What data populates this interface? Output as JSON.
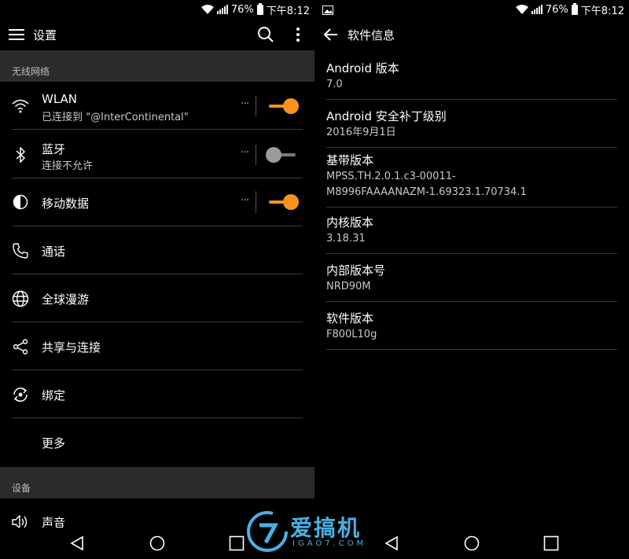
{
  "status_bar": {
    "battery": "76%",
    "time": "下午8:12"
  },
  "left": {
    "toolbar": {
      "title": "设置"
    },
    "sections": {
      "wireless": "无线网络",
      "device": "设备"
    },
    "items": {
      "wlan": {
        "label": "WLAN",
        "sub": "已连接到 \"@InterContinental\"",
        "more": "···",
        "toggle": "on"
      },
      "bluetooth": {
        "label": "蓝牙",
        "sub": "连接不允许",
        "more": "···",
        "toggle": "off"
      },
      "mobile_data": {
        "label": "移动数据",
        "more": "···",
        "toggle": "on"
      },
      "calls": {
        "label": "通话"
      },
      "global_roaming": {
        "label": "全球漫游"
      },
      "share_connect": {
        "label": "共享与连接"
      },
      "tethering": {
        "label": "绑定"
      },
      "more": {
        "label": "更多"
      },
      "sound": {
        "label": "声音"
      }
    }
  },
  "right": {
    "toolbar": {
      "title": "软件信息"
    },
    "info": [
      {
        "key": "Android 版本",
        "value": "7.0"
      },
      {
        "key": "Android 安全补丁级别",
        "value": "2016年9月1日"
      },
      {
        "key": "基带版本",
        "value": "MPSS.TH.2.0.1.c3-00011-",
        "value2": "M8996FAAAANAZM-1.69323.1.70734.1"
      },
      {
        "key": "内核版本",
        "value": "3.18.31"
      },
      {
        "key": "内部版本号",
        "value": "NRD90M"
      },
      {
        "key": "软件版本",
        "value": "F800L10g"
      }
    ]
  },
  "watermark": {
    "text": "爱搞机",
    "sub": "IGAO7.COM"
  },
  "colors": {
    "accent": "#f7931e",
    "background": "#000000",
    "section": "#2b2b2b",
    "watermark": "#4ab0e3"
  },
  "icons": [
    "menu-icon",
    "search-icon",
    "overflow-icon",
    "back-arrow-icon",
    "wifi-icon",
    "bluetooth-icon",
    "data-icon",
    "phone-icon",
    "globe-icon",
    "share-icon",
    "tether-icon",
    "sound-icon",
    "gallery-icon"
  ]
}
